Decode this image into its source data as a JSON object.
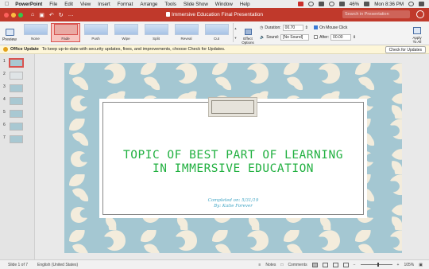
{
  "menubar": {
    "app_name": "PowerPoint",
    "menus": [
      "File",
      "Edit",
      "View",
      "Insert",
      "Format",
      "Arrange",
      "Tools",
      "Slide Show",
      "Window",
      "Help"
    ],
    "battery": "46%",
    "clock": "Mon 8:36 PM"
  },
  "titlebar": {
    "title": "Immersive Education Final Presentation",
    "search_placeholder": "Search in Presentation",
    "colors": {
      "accent": "#c0392b"
    }
  },
  "ribbon": {
    "preview_label": "Preview",
    "transitions": [
      {
        "label": "None"
      },
      {
        "label": "Fade"
      },
      {
        "label": "Push"
      },
      {
        "label": "Wipe"
      },
      {
        "label": "Split"
      },
      {
        "label": "Reveal"
      },
      {
        "label": "Cut"
      }
    ],
    "selected_transition": "Fade",
    "effect_options_line1": "Effect",
    "effect_options_line2": "Options",
    "duration_label": "Duration:",
    "duration_value": "00.70",
    "sound_label": "Sound:",
    "sound_value": "[No Sound]",
    "on_mouse_click_label": "On Mouse Click",
    "on_mouse_click_checked": true,
    "after_label": "After:",
    "after_value": "00.00",
    "apply_all_line1": "Apply",
    "apply_all_line2": "To All"
  },
  "update_bar": {
    "title": "Office Update",
    "message": "To keep up-to-date with security updates, fixes, and improvements, choose Check for Updates.",
    "button_label": "Check for Updates"
  },
  "thumbnails": [
    "1",
    "2",
    "3",
    "4",
    "5",
    "6",
    "7"
  ],
  "slide": {
    "title_line1": "TOPIC OF BEST PART OF LEARNING",
    "title_line2": "IN IMMERSIVE EDUCATION",
    "subtitle_line1": "Completed on: 5/31/19",
    "subtitle_line2": "By: Katie Forever"
  },
  "statusbar": {
    "slide_indicator": "Slide 1 of 7",
    "language": "English (United States)",
    "notes_label": "Notes",
    "comments_label": "Comments",
    "zoom": "105%"
  }
}
